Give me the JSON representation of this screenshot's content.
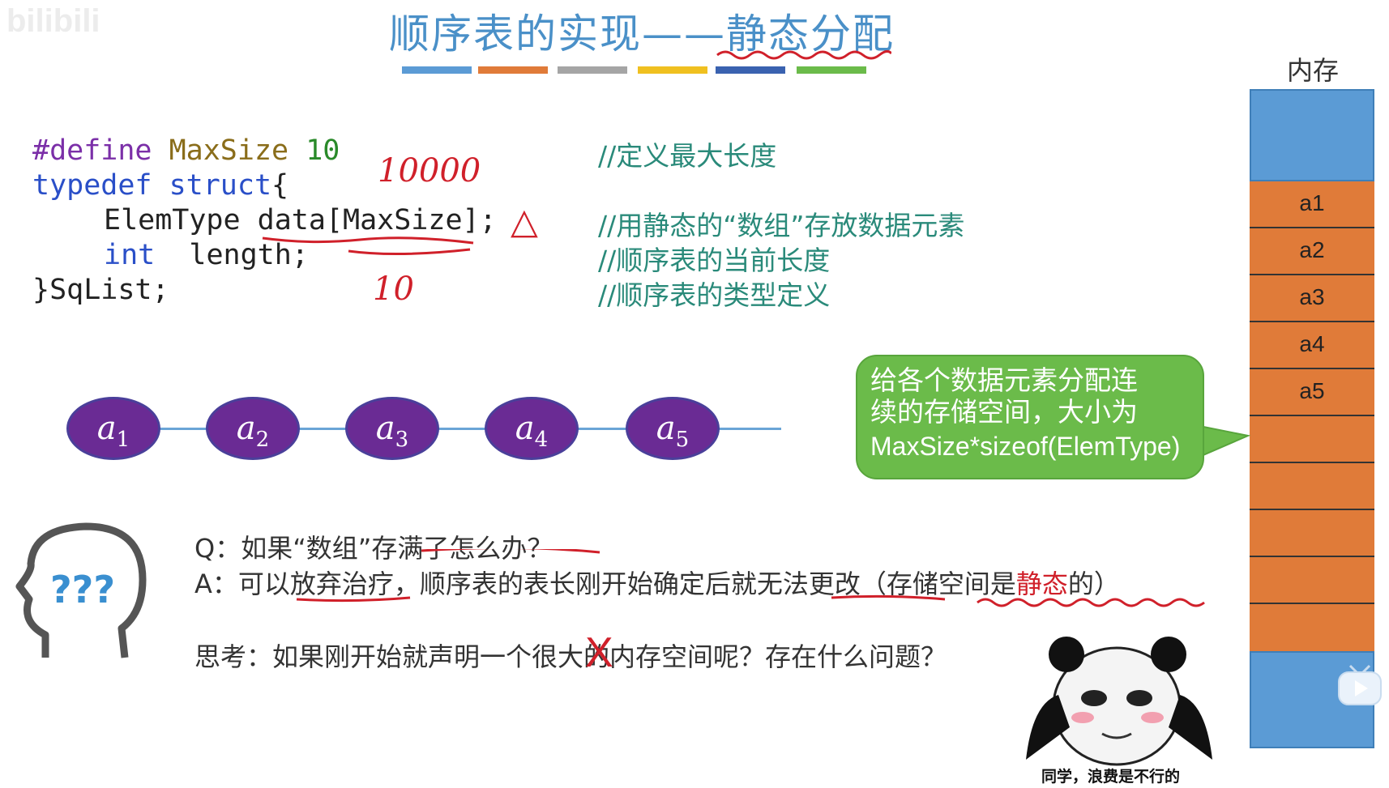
{
  "watermark": "bilibili",
  "title": "顺序表的实现——静态分配",
  "title_bars": [
    "#5b9bd5",
    "#e07b39",
    "#a5a5a5",
    "#f0c020",
    "#3a62b0",
    "#6bbb4a"
  ],
  "memory": {
    "label": "内存",
    "cells": [
      "a1",
      "a2",
      "a3",
      "a4",
      "a5",
      "",
      "",
      "",
      "",
      ""
    ],
    "colors": {
      "free": "#5b9bd5",
      "allocated": "#e07b39"
    }
  },
  "code": {
    "line1": {
      "kw": "#define",
      "name": "MaxSize",
      "value": "10"
    },
    "line2": {
      "kw1": "typedef",
      "kw2": "struct",
      "brace": "{"
    },
    "line3": {
      "type": "ElemType",
      "field": "data[MaxSize];"
    },
    "line4": {
      "kw": "int",
      "field": "length;"
    },
    "line5": "}SqList;"
  },
  "comments": {
    "c1": "//定义最大长度",
    "c2": "//用静态的“数组”存放数据元素",
    "c3": "//顺序表的当前长度",
    "c4": "//顺序表的类型定义"
  },
  "annotations": {
    "big": "10000",
    "small": "10",
    "triangle": "△",
    "cross": "X"
  },
  "nodes": [
    {
      "letter": "a",
      "sub": "1"
    },
    {
      "letter": "a",
      "sub": "2"
    },
    {
      "letter": "a",
      "sub": "3"
    },
    {
      "letter": "a",
      "sub": "4"
    },
    {
      "letter": "a",
      "sub": "5"
    }
  ],
  "callout": {
    "line1": "给各个数据元素分配连",
    "line2": "续的存储空间，大小为",
    "line3": "MaxSize*sizeof(ElemType)"
  },
  "qa": {
    "q": "Q：如果“数组”存满了怎么办？",
    "a_prefix": "A：可以放弃治疗，顺序表的表长刚开始确定后就无法更改（存储空间是",
    "a_red": "静态",
    "a_suffix": "的）",
    "think": "思考：如果刚开始就声明一个很大的内存空间呢？存在什么问题？"
  },
  "meme_caption": "同学，浪费是不行的",
  "player": {
    "icon": "tv-icon"
  }
}
